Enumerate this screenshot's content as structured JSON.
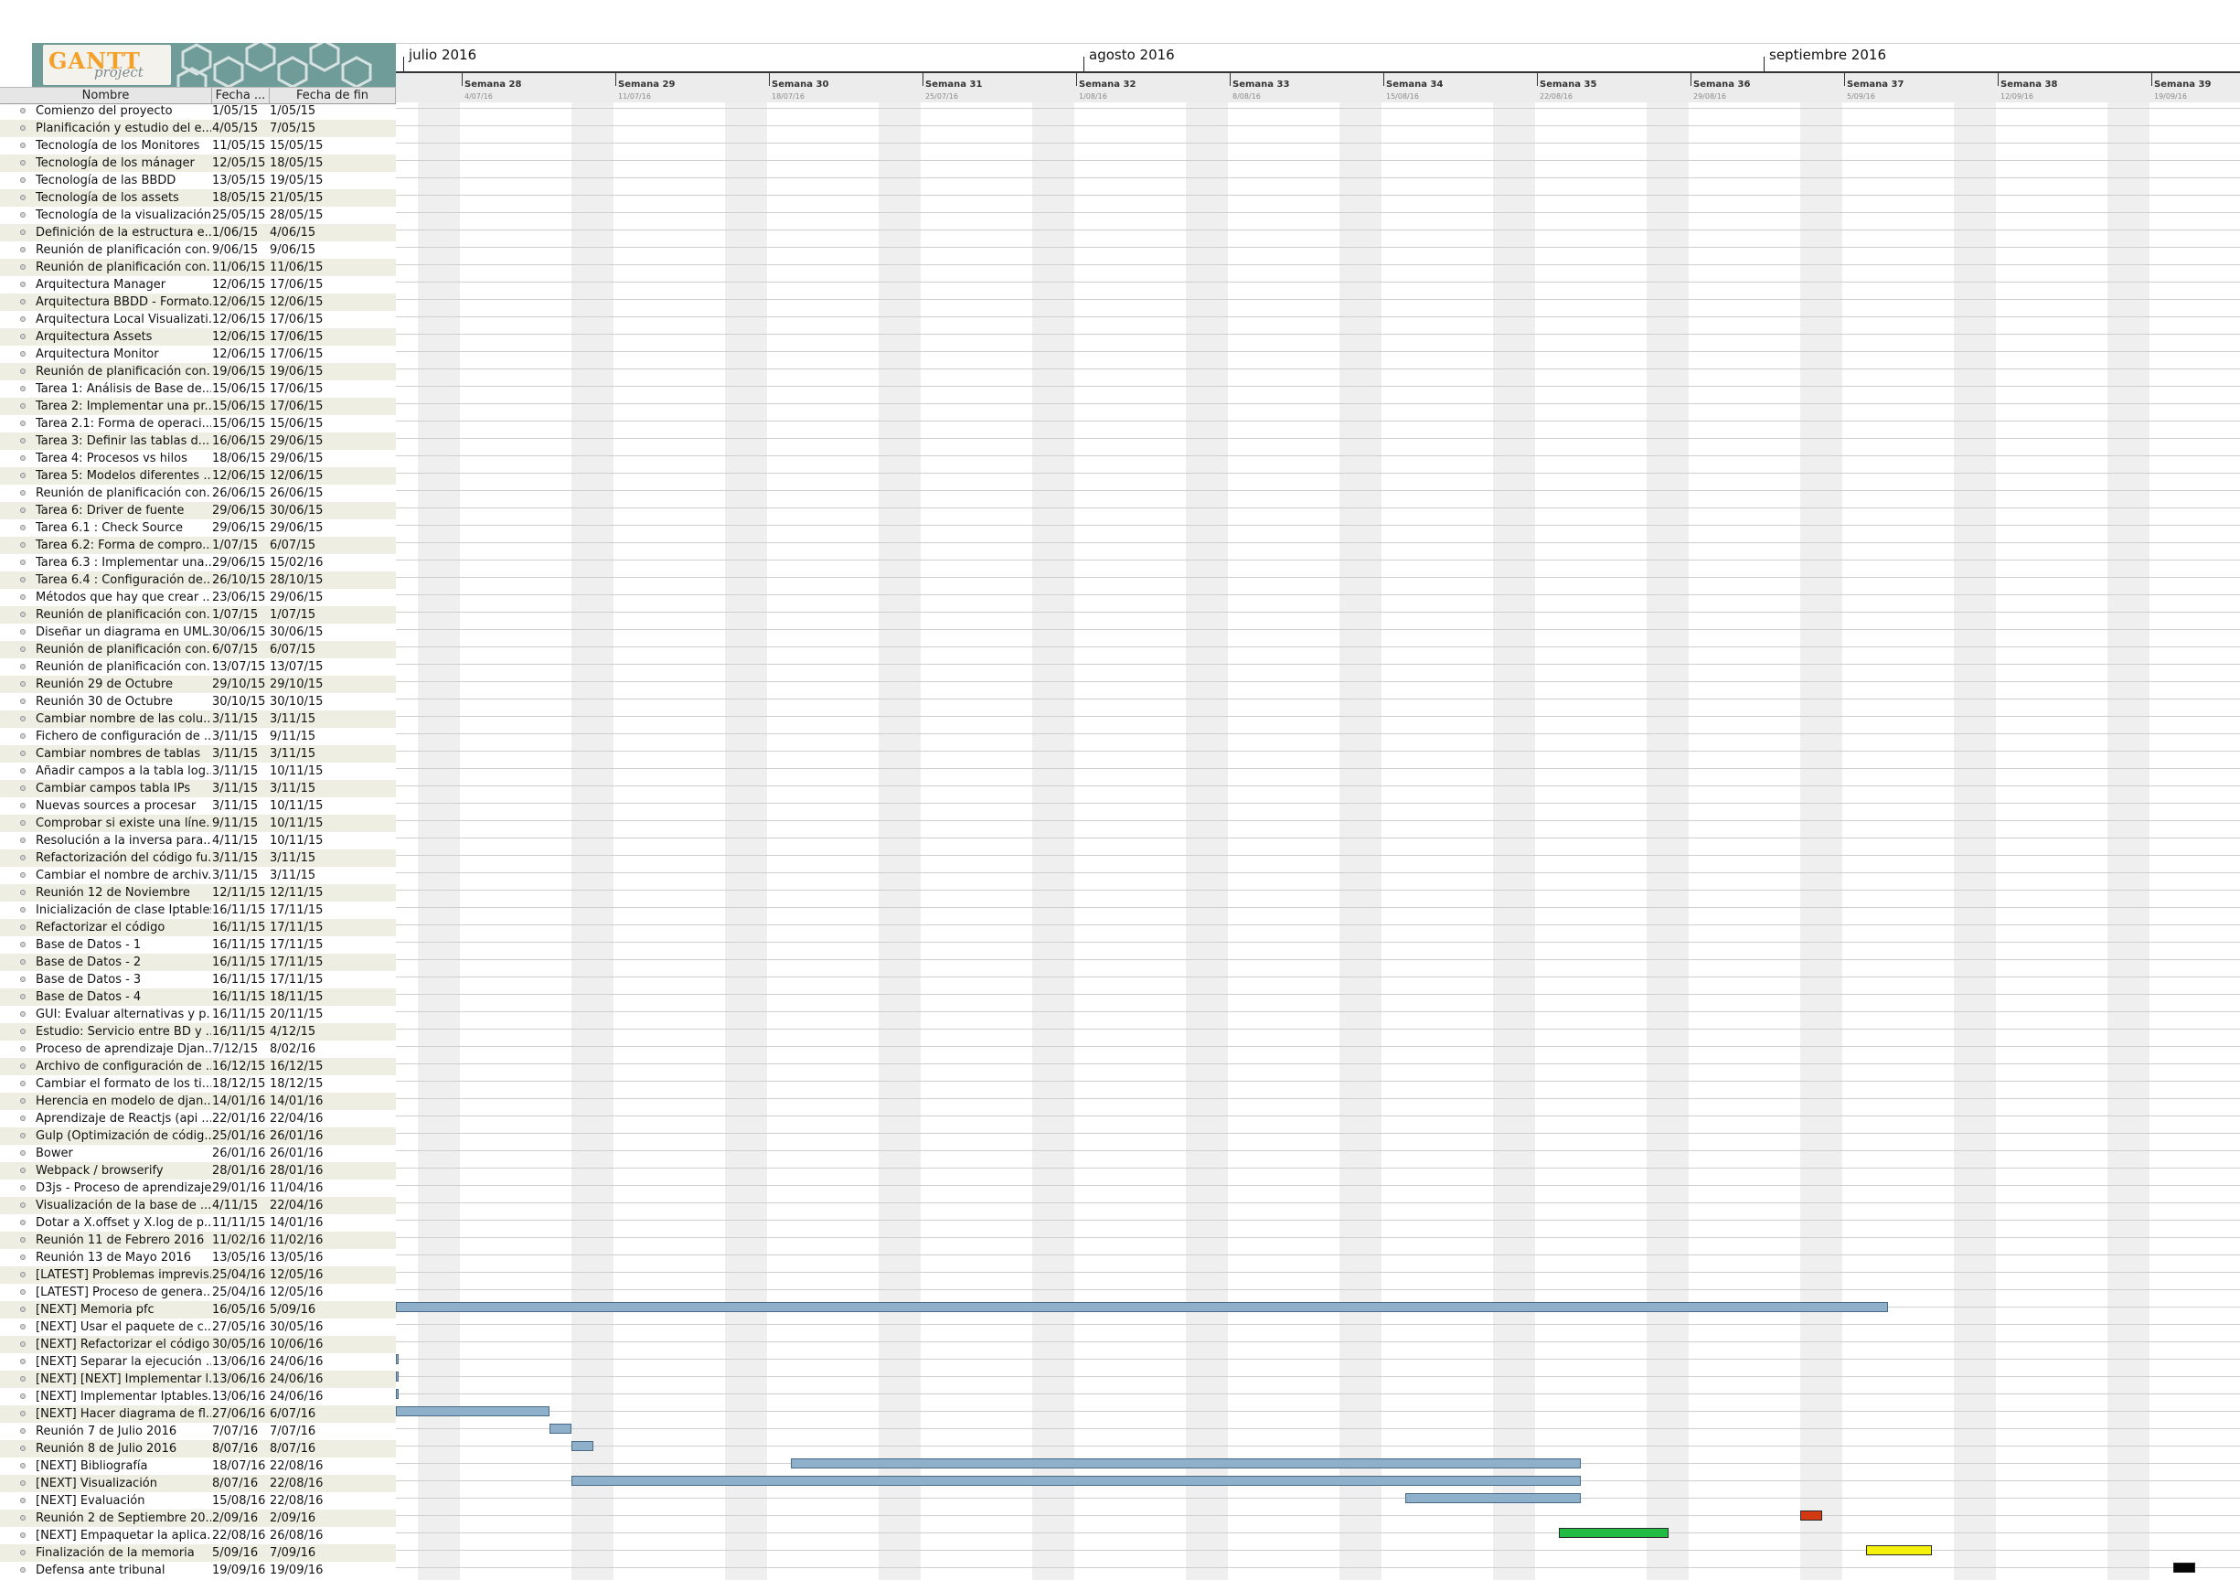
{
  "app": {
    "logo_text": "GANTT",
    "logo_subtext": "project"
  },
  "columns": {
    "name": "Nombre",
    "start": "Fecha ...",
    "end": "Fecha de fin"
  },
  "timeline": {
    "months": [
      {
        "label": "julio 2016"
      },
      {
        "label": "agosto 2016"
      },
      {
        "label": "septiembre 2016"
      }
    ],
    "weeks": [
      {
        "name": "Semana 28",
        "date": "4/07/16"
      },
      {
        "name": "Semana 29",
        "date": "11/07/16"
      },
      {
        "name": "Semana 30",
        "date": "18/07/16"
      },
      {
        "name": "Semana 31",
        "date": "25/07/16"
      },
      {
        "name": "Semana 32",
        "date": "1/08/16"
      },
      {
        "name": "Semana 33",
        "date": "8/08/16"
      },
      {
        "name": "Semana 34",
        "date": "15/08/16"
      },
      {
        "name": "Semana 35",
        "date": "22/08/16"
      },
      {
        "name": "Semana 36",
        "date": "29/08/16"
      },
      {
        "name": "Semana 37",
        "date": "5/09/16"
      },
      {
        "name": "Semana 38",
        "date": "12/09/16"
      },
      {
        "name": "Semana 39",
        "date": "19/09/16"
      }
    ]
  },
  "tasks": [
    {
      "name": "Comienzo del proyecto",
      "start": "1/05/15",
      "end": "1/05/15"
    },
    {
      "name": "Planificación y estudio del e...",
      "start": "4/05/15",
      "end": "7/05/15"
    },
    {
      "name": "Tecnología de los Monitores",
      "start": "11/05/15",
      "end": "15/05/15"
    },
    {
      "name": "Tecnología de los mánager",
      "start": "12/05/15",
      "end": "18/05/15"
    },
    {
      "name": "Tecnología de las BBDD",
      "start": "13/05/15",
      "end": "19/05/15"
    },
    {
      "name": "Tecnología de los assets",
      "start": "18/05/15",
      "end": "21/05/15"
    },
    {
      "name": "Tecnología de la visualización",
      "start": "25/05/15",
      "end": "28/05/15"
    },
    {
      "name": "Definición de la estructura e...",
      "start": "1/06/15",
      "end": "4/06/15"
    },
    {
      "name": "Reunión de planificación con...",
      "start": "9/06/15",
      "end": "9/06/15"
    },
    {
      "name": "Reunión de planificación con...",
      "start": "11/06/15",
      "end": "11/06/15"
    },
    {
      "name": "Arquitectura Manager",
      "start": "12/06/15",
      "end": "17/06/15"
    },
    {
      "name": "Arquitectura BBDD - Formato...",
      "start": "12/06/15",
      "end": "12/06/15"
    },
    {
      "name": "Arquitectura Local Visualizati...",
      "start": "12/06/15",
      "end": "17/06/15"
    },
    {
      "name": "Arquitectura Assets",
      "start": "12/06/15",
      "end": "17/06/15"
    },
    {
      "name": "Arquitectura Monitor",
      "start": "12/06/15",
      "end": "17/06/15"
    },
    {
      "name": "Reunión de planificación con...",
      "start": "19/06/15",
      "end": "19/06/15"
    },
    {
      "name": "Tarea 1: Análisis de Base de...",
      "start": "15/06/15",
      "end": "17/06/15"
    },
    {
      "name": "Tarea 2: Implementar una pr...",
      "start": "15/06/15",
      "end": "17/06/15"
    },
    {
      "name": "Tarea 2.1: Forma de operaci...",
      "start": "15/06/15",
      "end": "15/06/15"
    },
    {
      "name": "Tarea 3: Definir las tablas d...",
      "start": "16/06/15",
      "end": "29/06/15"
    },
    {
      "name": "Tarea 4: Procesos vs hilos",
      "start": "18/06/15",
      "end": "29/06/15"
    },
    {
      "name": "Tarea 5: Modelos diferentes ...",
      "start": "12/06/15",
      "end": "12/06/15"
    },
    {
      "name": "Reunión de planificación con...",
      "start": "26/06/15",
      "end": "26/06/15"
    },
    {
      "name": "Tarea 6: Driver de fuente",
      "start": "29/06/15",
      "end": "30/06/15"
    },
    {
      "name": "Tarea 6.1 : Check Source",
      "start": "29/06/15",
      "end": "29/06/15"
    },
    {
      "name": "Tarea 6.2: Forma de compro...",
      "start": "1/07/15",
      "end": "6/07/15"
    },
    {
      "name": "Tarea 6.3 : Implementar una...",
      "start": "29/06/15",
      "end": "15/02/16"
    },
    {
      "name": "Tarea 6.4 : Configuración de...",
      "start": "26/10/15",
      "end": "28/10/15"
    },
    {
      "name": "Métodos que hay que crear ...",
      "start": "23/06/15",
      "end": "29/06/15"
    },
    {
      "name": "Reunión de planificación con...",
      "start": "1/07/15",
      "end": "1/07/15"
    },
    {
      "name": "Diseñar un diagrama en UML...",
      "start": "30/06/15",
      "end": "30/06/15"
    },
    {
      "name": "Reunión de planificación con...",
      "start": "6/07/15",
      "end": "6/07/15"
    },
    {
      "name": "Reunión de planificación con...",
      "start": "13/07/15",
      "end": "13/07/15"
    },
    {
      "name": "Reunión 29 de Octubre",
      "start": "29/10/15",
      "end": "29/10/15"
    },
    {
      "name": "Reunión 30 de Octubre",
      "start": "30/10/15",
      "end": "30/10/15"
    },
    {
      "name": "Cambiar nombre de las colu...",
      "start": "3/11/15",
      "end": "3/11/15"
    },
    {
      "name": "Fichero de configuración de ...",
      "start": "3/11/15",
      "end": "9/11/15"
    },
    {
      "name": "Cambiar nombres de tablas",
      "start": "3/11/15",
      "end": "3/11/15"
    },
    {
      "name": "Añadir campos a la tabla log...",
      "start": "3/11/15",
      "end": "10/11/15"
    },
    {
      "name": "Cambiar campos tabla IPs",
      "start": "3/11/15",
      "end": "3/11/15"
    },
    {
      "name": "Nuevas sources a procesar",
      "start": "3/11/15",
      "end": "10/11/15"
    },
    {
      "name": "Comprobar si existe una líne...",
      "start": "9/11/15",
      "end": "10/11/15"
    },
    {
      "name": "Resolución a la inversa para...",
      "start": "4/11/15",
      "end": "10/11/15"
    },
    {
      "name": "Refactorización del código fu...",
      "start": "3/11/15",
      "end": "3/11/15"
    },
    {
      "name": "Cambiar el nombre de archiv...",
      "start": "3/11/15",
      "end": "3/11/15"
    },
    {
      "name": "Reunión 12 de Noviembre",
      "start": "12/11/15",
      "end": "12/11/15"
    },
    {
      "name": "Inicialización de clase Iptables",
      "start": "16/11/15",
      "end": "17/11/15"
    },
    {
      "name": "Refactorizar el código",
      "start": "16/11/15",
      "end": "17/11/15"
    },
    {
      "name": "Base de Datos - 1",
      "start": "16/11/15",
      "end": "17/11/15"
    },
    {
      "name": "Base de Datos - 2",
      "start": "16/11/15",
      "end": "17/11/15"
    },
    {
      "name": "Base de Datos - 3",
      "start": "16/11/15",
      "end": "17/11/15"
    },
    {
      "name": "Base de Datos - 4",
      "start": "16/11/15",
      "end": "18/11/15"
    },
    {
      "name": "GUI: Evaluar alternativas y p...",
      "start": "16/11/15",
      "end": "20/11/15"
    },
    {
      "name": "Estudio: Servicio entre BD y ...",
      "start": "16/11/15",
      "end": "4/12/15"
    },
    {
      "name": "Proceso de aprendizaje Djan...",
      "start": "7/12/15",
      "end": "8/02/16"
    },
    {
      "name": "Archivo de configuración de ...",
      "start": "16/12/15",
      "end": "16/12/15"
    },
    {
      "name": "Cambiar el formato de los ti...",
      "start": "18/12/15",
      "end": "18/12/15"
    },
    {
      "name": "Herencia en modelo de djan...",
      "start": "14/01/16",
      "end": "14/01/16"
    },
    {
      "name": "Aprendizaje de Reactjs (api ...",
      "start": "22/01/16",
      "end": "22/04/16"
    },
    {
      "name": "Gulp (Optimización de códig...",
      "start": "25/01/16",
      "end": "26/01/16"
    },
    {
      "name": "Bower",
      "start": "26/01/16",
      "end": "26/01/16"
    },
    {
      "name": "Webpack / browserify",
      "start": "28/01/16",
      "end": "28/01/16"
    },
    {
      "name": "D3js - Proceso de aprendizaje",
      "start": "29/01/16",
      "end": "11/04/16"
    },
    {
      "name": "Visualización de la base de ...",
      "start": "4/11/15",
      "end": "22/04/16"
    },
    {
      "name": "Dotar a X.offset y X.log de p...",
      "start": "11/11/15",
      "end": "14/01/16"
    },
    {
      "name": "Reunión 11 de Febrero 2016",
      "start": "11/02/16",
      "end": "11/02/16"
    },
    {
      "name": "Reunión 13 de Mayo 2016",
      "start": "13/05/16",
      "end": "13/05/16"
    },
    {
      "name": "[LATEST] Problemas imprevis...",
      "start": "25/04/16",
      "end": "12/05/16"
    },
    {
      "name": "[LATEST] Proceso de genera...",
      "start": "25/04/16",
      "end": "12/05/16"
    },
    {
      "name": "[NEXT] Memoria pfc",
      "start": "16/05/16",
      "end": "5/09/16"
    },
    {
      "name": "[NEXT] Usar el paquete de c...",
      "start": "27/05/16",
      "end": "30/05/16"
    },
    {
      "name": "[NEXT] Refactorizar el código",
      "start": "30/05/16",
      "end": "10/06/16"
    },
    {
      "name": "[NEXT] Separar la ejecución ...",
      "start": "13/06/16",
      "end": "24/06/16"
    },
    {
      "name": "[NEXT] [NEXT] Implementar l...",
      "start": "13/06/16",
      "end": "24/06/16"
    },
    {
      "name": "[NEXT] Implementar Iptables...",
      "start": "13/06/16",
      "end": "24/06/16"
    },
    {
      "name": "[NEXT] Hacer diagrama de fl...",
      "start": "27/06/16",
      "end": "6/07/16"
    },
    {
      "name": "Reunión 7 de Julio 2016",
      "start": "7/07/16",
      "end": "7/07/16"
    },
    {
      "name": "Reunión 8 de Julio 2016",
      "start": "8/07/16",
      "end": "8/07/16"
    },
    {
      "name": "[NEXT] Bibliografía",
      "start": "18/07/16",
      "end": "22/08/16"
    },
    {
      "name": "[NEXT] Visualización",
      "start": "8/07/16",
      "end": "22/08/16"
    },
    {
      "name": "[NEXT] Evaluación",
      "start": "15/08/16",
      "end": "22/08/16"
    },
    {
      "name": "Reunión 2 de Septiembre 20...",
      "start": "2/09/16",
      "end": "2/09/16"
    },
    {
      "name": "[NEXT] Empaquetar la aplica...",
      "start": "22/08/16",
      "end": "26/08/16"
    },
    {
      "name": "Finalización de la memoria",
      "start": "5/09/16",
      "end": "7/09/16"
    },
    {
      "name": "Defensa ante tribunal",
      "start": "19/09/16",
      "end": "19/09/16"
    }
  ],
  "bars": [
    {
      "row": 69,
      "from": "2016-06-30",
      "to": "2016-09-06",
      "color": "#8fb0cb"
    },
    {
      "row": 72,
      "from": "2016-06-30",
      "to": "2016-07-01",
      "color": "#8fb0cb",
      "thin": true
    },
    {
      "row": 73,
      "from": "2016-06-30",
      "to": "2016-07-01",
      "color": "#8fb0cb",
      "thin": true
    },
    {
      "row": 74,
      "from": "2016-06-30",
      "to": "2016-07-01",
      "color": "#8fb0cb",
      "thin": true
    },
    {
      "row": 75,
      "from": "2016-06-30",
      "to": "2016-07-07",
      "color": "#8fb0cb"
    },
    {
      "row": 76,
      "from": "2016-07-07",
      "to": "2016-07-08",
      "color": "#8fb0cb"
    },
    {
      "row": 77,
      "from": "2016-07-08",
      "to": "2016-07-09",
      "color": "#8fb0cb"
    },
    {
      "row": 78,
      "from": "2016-07-18",
      "to": "2016-08-23",
      "color": "#8fb0cb"
    },
    {
      "row": 79,
      "from": "2016-07-08",
      "to": "2016-08-23",
      "color": "#8fb0cb"
    },
    {
      "row": 80,
      "from": "2016-08-15",
      "to": "2016-08-23",
      "color": "#8fb0cb"
    },
    {
      "row": 81,
      "from": "2016-09-02",
      "to": "2016-09-03",
      "color": "#d33a12"
    },
    {
      "row": 82,
      "from": "2016-08-22",
      "to": "2016-08-27",
      "color": "#22bb44"
    },
    {
      "row": 83,
      "from": "2016-09-05",
      "to": "2016-09-08",
      "color": "#f4f20c"
    },
    {
      "row": 84,
      "from": "2016-09-19",
      "to": "2016-09-20",
      "color": "#050505"
    }
  ]
}
